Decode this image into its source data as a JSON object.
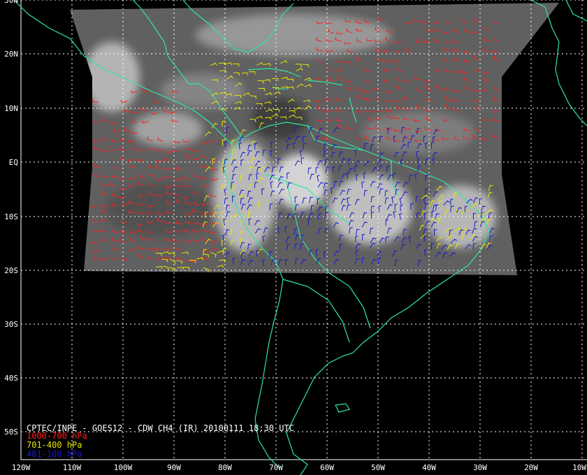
{
  "map": {
    "title": "CPTEC/INPE - GOES12 - CDW CH4 (IR) 20100111 18:30 UTC",
    "lat_labels": [
      "30N",
      "20N",
      "10N",
      "EQ",
      "10S",
      "20S",
      "30S",
      "40S",
      "50S"
    ],
    "lon_labels": [
      "120W",
      "110W",
      "100W",
      "90W",
      "80W",
      "70W",
      "60W",
      "50W",
      "40W",
      "30W",
      "20W",
      "10W"
    ],
    "legend": [
      {
        "label": "1000-700 hPa",
        "color": "#ff2020"
      },
      {
        "label": "701-400 hPa",
        "color": "#e6e600"
      },
      {
        "label": "401-100 hPa",
        "color": "#1a1acc"
      }
    ],
    "colors": {
      "background": "#000000",
      "grid": "#ffffff",
      "coastline": "#2ee6a0",
      "satellite": "#606060"
    }
  }
}
